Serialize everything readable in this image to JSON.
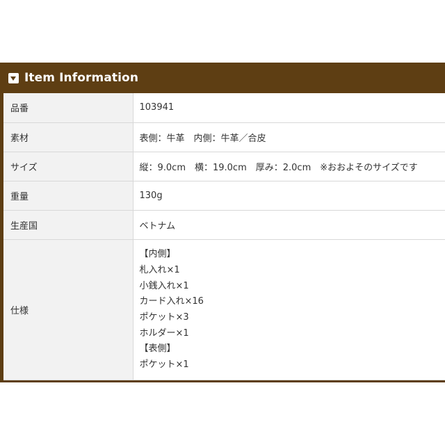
{
  "header": {
    "title": "Item Information",
    "icon": "caret-down-square-icon"
  },
  "rows": [
    {
      "label": "品番",
      "value": "103941"
    },
    {
      "label": "素材",
      "value": "表側：牛革　内側：牛革／合皮"
    },
    {
      "label": "サイズ",
      "value": "縦：9.0cm　横：19.0cm　厚み：2.0cm　※おおよそのサイズです"
    },
    {
      "label": "重量",
      "value": "130g"
    },
    {
      "label": "生産国",
      "value": "ベトナム"
    }
  ],
  "spec": {
    "label": "仕様",
    "lines": [
      "【内側】",
      "札入れ×1",
      "小銭入れ×1",
      "カード入れ×16",
      "ポケット×3",
      "ホルダー×1",
      "【表側】",
      "ポケット×1"
    ]
  },
  "colors": {
    "header_bg": "#5e3e13",
    "label_bg": "#f2f2f2",
    "border": "#d8d8d8"
  }
}
